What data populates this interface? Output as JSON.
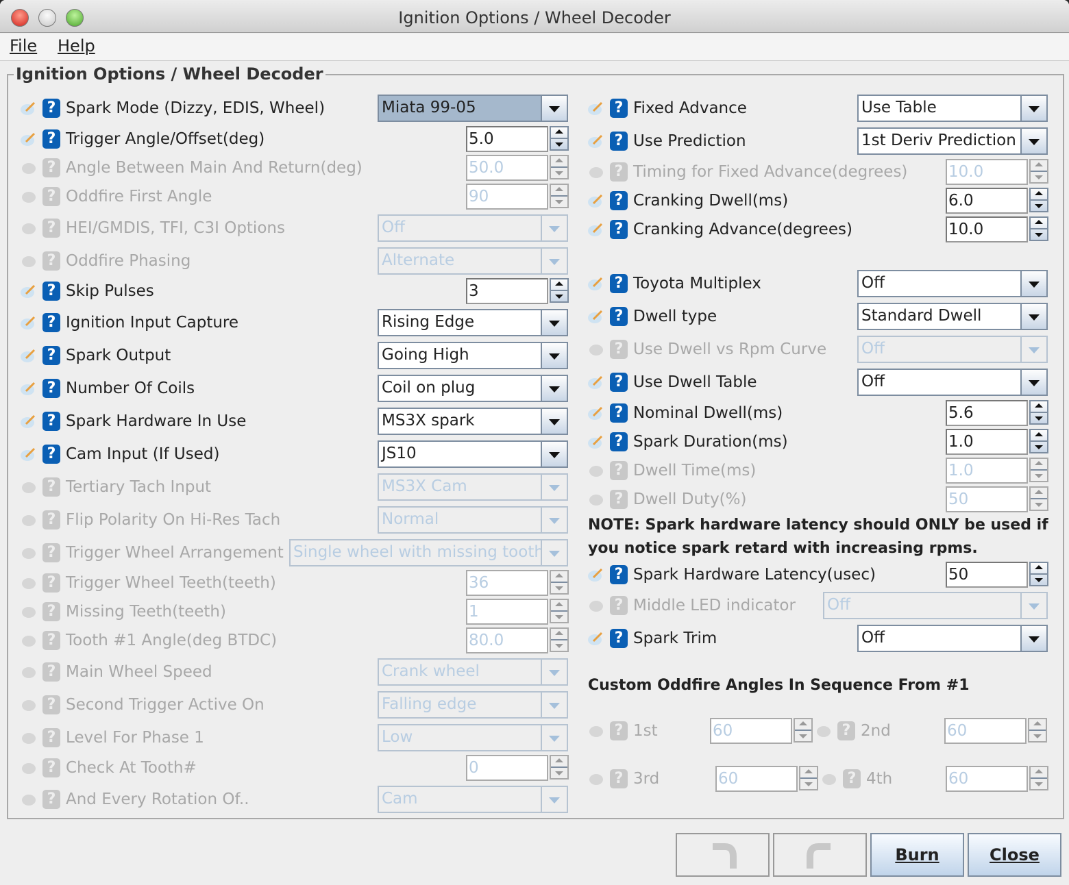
{
  "window": {
    "title": "Ignition Options / Wheel Decoder"
  },
  "menu": {
    "file": "File",
    "help": "Help"
  },
  "panel": {
    "title": "Ignition Options / Wheel Decoder"
  },
  "left": [
    {
      "label": "Spark Mode (Dizzy, EDIS, Wheel)",
      "type": "combo",
      "value": "Miata 99-05",
      "enabled": true,
      "selected": true
    },
    {
      "label": "Trigger Angle/Offset(deg)",
      "type": "spin",
      "value": "5.0",
      "enabled": true
    },
    {
      "label": "Angle Between Main And Return(deg)",
      "type": "spin",
      "value": "50.0",
      "enabled": false
    },
    {
      "label": "Oddfire First Angle",
      "type": "spin",
      "value": "90",
      "enabled": false
    },
    {
      "label": "HEI/GMDIS, TFI, C3I Options",
      "type": "combo",
      "value": "Off",
      "enabled": false
    },
    {
      "label": "Oddfire Phasing",
      "type": "combo",
      "value": "Alternate",
      "enabled": false
    },
    {
      "label": "Skip Pulses",
      "type": "spin",
      "value": "3",
      "enabled": true
    },
    {
      "label": "Ignition Input Capture",
      "type": "combo",
      "value": "Rising Edge",
      "enabled": true
    },
    {
      "label": "Spark Output",
      "type": "combo",
      "value": "Going High",
      "enabled": true
    },
    {
      "label": "Number Of Coils",
      "type": "combo",
      "value": "Coil on plug",
      "enabled": true
    },
    {
      "label": "Spark Hardware In Use",
      "type": "combo",
      "value": "MS3X spark",
      "enabled": true
    },
    {
      "label": "Cam Input (If Used)",
      "type": "combo",
      "value": "JS10",
      "enabled": true
    },
    {
      "label": "Tertiary Tach Input",
      "type": "combo",
      "value": "MS3X Cam",
      "enabled": false
    },
    {
      "label": "Flip Polarity On Hi-Res Tach",
      "type": "combo",
      "value": "Normal",
      "enabled": false
    },
    {
      "label": "Trigger Wheel Arrangement",
      "type": "combo",
      "value": "Single wheel with missing tooth",
      "enabled": false,
      "wide": true
    },
    {
      "label": "Trigger Wheel Teeth(teeth)",
      "type": "spin",
      "value": "36",
      "enabled": false
    },
    {
      "label": "Missing Teeth(teeth)",
      "type": "spin",
      "value": "1",
      "enabled": false
    },
    {
      "label": "Tooth #1 Angle(deg BTDC)",
      "type": "spin",
      "value": "80.0",
      "enabled": false
    },
    {
      "label": "Main Wheel Speed",
      "type": "combo",
      "value": "Crank wheel",
      "enabled": false
    },
    {
      "label": "Second Trigger Active On",
      "type": "combo",
      "value": "Falling edge",
      "enabled": false
    },
    {
      "label": "Level For Phase 1",
      "type": "combo",
      "value": "Low",
      "enabled": false
    },
    {
      "label": "Check At Tooth#",
      "type": "spin",
      "value": "0",
      "enabled": false
    },
    {
      "label": "And Every Rotation Of..",
      "type": "combo",
      "value": "Cam",
      "enabled": false
    }
  ],
  "right": [
    {
      "label": "Fixed Advance",
      "type": "combo",
      "value": "Use Table",
      "enabled": true
    },
    {
      "label": "Use Prediction",
      "type": "combo",
      "value": "1st Deriv Prediction",
      "enabled": true
    },
    {
      "label": "Timing for Fixed Advance(degrees)",
      "type": "spin",
      "value": "10.0",
      "enabled": false
    },
    {
      "label": "Cranking Dwell(ms)",
      "type": "spin",
      "value": "6.0",
      "enabled": true
    },
    {
      "label": "Cranking Advance(degrees)",
      "type": "spin",
      "value": "10.0",
      "enabled": true
    },
    {
      "label": "Toyota Multiplex",
      "type": "combo",
      "value": "Off",
      "enabled": true
    },
    {
      "label": "Dwell type",
      "type": "combo",
      "value": "Standard Dwell",
      "enabled": true
    },
    {
      "label": "Use Dwell vs Rpm Curve",
      "type": "combo",
      "value": "Off",
      "enabled": false
    },
    {
      "label": "Use Dwell Table",
      "type": "combo",
      "value": "Off",
      "enabled": true
    },
    {
      "label": "Nominal Dwell(ms)",
      "type": "spin",
      "value": "5.6",
      "enabled": true
    },
    {
      "label": "Spark Duration(ms)",
      "type": "spin",
      "value": "1.0",
      "enabled": true
    },
    {
      "label": "Dwell Time(ms)",
      "type": "spin",
      "value": "1.0",
      "enabled": false
    },
    {
      "label": "Dwell Duty(%)",
      "type": "spin",
      "value": "50",
      "enabled": false
    },
    {
      "label": "Spark Hardware Latency(usec)",
      "type": "spin",
      "value": "50",
      "enabled": true
    },
    {
      "label": "Middle LED indicator",
      "type": "combo",
      "value": "Off",
      "enabled": false,
      "wide": true
    },
    {
      "label": "Spark Trim",
      "type": "combo",
      "value": "Off",
      "enabled": true
    }
  ],
  "note": "NOTE: Spark hardware latency should ONLY be used if you notice spark retard with increasing rpms.",
  "oddfire": {
    "heading": "Custom Oddfire Angles In Sequence From #1",
    "items": [
      {
        "label": "1st",
        "value": "60"
      },
      {
        "label": "2nd",
        "value": "60"
      },
      {
        "label": "3rd",
        "value": "60"
      },
      {
        "label": "4th",
        "value": "60"
      }
    ]
  },
  "buttons": {
    "burn": "Burn",
    "close": "Close"
  }
}
